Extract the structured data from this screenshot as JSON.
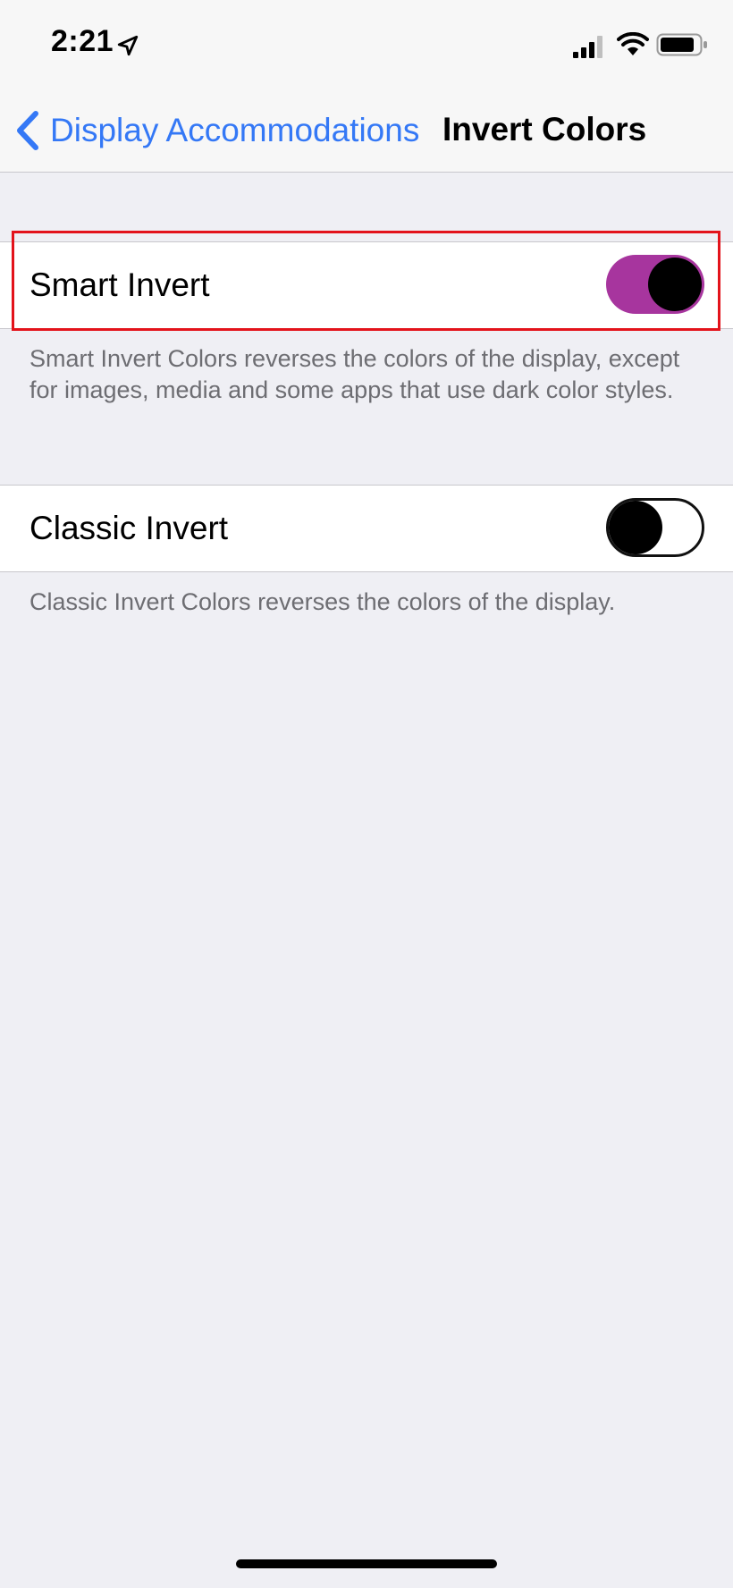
{
  "status_bar": {
    "time": "2:21",
    "icons": [
      "location-arrow-icon",
      "cellular-signal-icon",
      "wifi-icon",
      "battery-icon"
    ]
  },
  "nav": {
    "back_label": "Display Accommodations",
    "title": "Invert Colors",
    "accent_color": "#3478f6"
  },
  "settings": [
    {
      "label": "Smart Invert",
      "enabled": true,
      "description": "Smart Invert Colors reverses the colors of the display, except for images, media and some apps that use dark color styles."
    },
    {
      "label": "Classic Invert",
      "enabled": false,
      "description": "Classic Invert Colors reverses the colors of the display."
    }
  ],
  "colors": {
    "toggle_on": "#a7359e",
    "highlight": "#e3131b",
    "background": "#efeff4"
  }
}
